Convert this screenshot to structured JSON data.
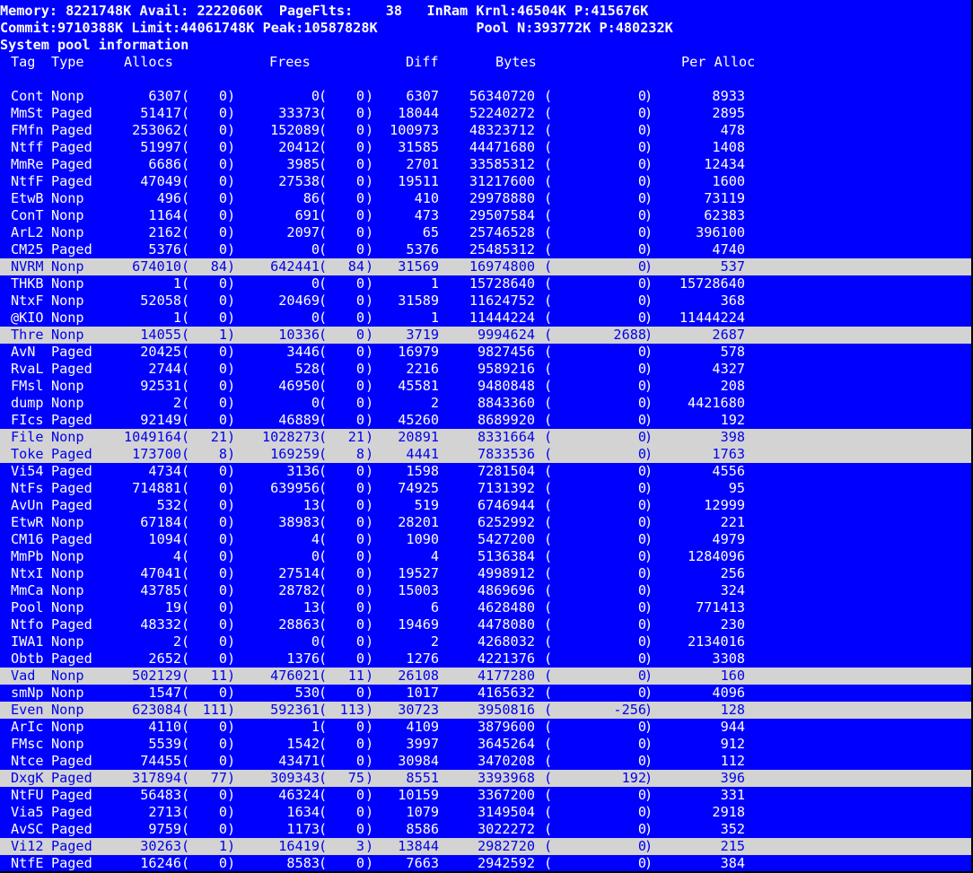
{
  "header": {
    "line1": "Memory: 8221748K Avail: 2222060K  PageFlts:    38   InRam Krnl:46504K P:415676K",
    "line2": "Commit:9710388K Limit:44061748K Peak:10587828K            Pool N:393772K P:480232K",
    "line3": "System pool information"
  },
  "columns": {
    "tag": "Tag",
    "type": "Type",
    "allocs": "Allocs",
    "frees": "Frees",
    "diff": "Diff",
    "bytes": "Bytes",
    "per_alloc": "Per Alloc"
  },
  "colors": {
    "background": "#0000ff",
    "text": "#ffffff",
    "highlight_bg": "#d3d3d3",
    "highlight_text": "#0000ee"
  },
  "rows": [
    {
      "tag": "Cont",
      "type": "Nonp",
      "allocs": "6307",
      "allocs_diff": "0",
      "frees": "0",
      "frees_diff": "0",
      "diff": "6307",
      "bytes": "56340720",
      "bytes_diff": "0",
      "per_alloc": "8933",
      "highlight": false
    },
    {
      "tag": "MmSt",
      "type": "Paged",
      "allocs": "51417",
      "allocs_diff": "0",
      "frees": "33373",
      "frees_diff": "0",
      "diff": "18044",
      "bytes": "52240272",
      "bytes_diff": "0",
      "per_alloc": "2895",
      "highlight": false
    },
    {
      "tag": "FMfn",
      "type": "Paged",
      "allocs": "253062",
      "allocs_diff": "0",
      "frees": "152089",
      "frees_diff": "0",
      "diff": "100973",
      "bytes": "48323712",
      "bytes_diff": "0",
      "per_alloc": "478",
      "highlight": false
    },
    {
      "tag": "Ntff",
      "type": "Paged",
      "allocs": "51997",
      "allocs_diff": "0",
      "frees": "20412",
      "frees_diff": "0",
      "diff": "31585",
      "bytes": "44471680",
      "bytes_diff": "0",
      "per_alloc": "1408",
      "highlight": false
    },
    {
      "tag": "MmRe",
      "type": "Paged",
      "allocs": "6686",
      "allocs_diff": "0",
      "frees": "3985",
      "frees_diff": "0",
      "diff": "2701",
      "bytes": "33585312",
      "bytes_diff": "0",
      "per_alloc": "12434",
      "highlight": false
    },
    {
      "tag": "NtfF",
      "type": "Paged",
      "allocs": "47049",
      "allocs_diff": "0",
      "frees": "27538",
      "frees_diff": "0",
      "diff": "19511",
      "bytes": "31217600",
      "bytes_diff": "0",
      "per_alloc": "1600",
      "highlight": false
    },
    {
      "tag": "EtwB",
      "type": "Nonp",
      "allocs": "496",
      "allocs_diff": "0",
      "frees": "86",
      "frees_diff": "0",
      "diff": "410",
      "bytes": "29978880",
      "bytes_diff": "0",
      "per_alloc": "73119",
      "highlight": false
    },
    {
      "tag": "ConT",
      "type": "Nonp",
      "allocs": "1164",
      "allocs_diff": "0",
      "frees": "691",
      "frees_diff": "0",
      "diff": "473",
      "bytes": "29507584",
      "bytes_diff": "0",
      "per_alloc": "62383",
      "highlight": false
    },
    {
      "tag": "ArL2",
      "type": "Nonp",
      "allocs": "2162",
      "allocs_diff": "0",
      "frees": "2097",
      "frees_diff": "0",
      "diff": "65",
      "bytes": "25746528",
      "bytes_diff": "0",
      "per_alloc": "396100",
      "highlight": false
    },
    {
      "tag": "CM25",
      "type": "Paged",
      "allocs": "5376",
      "allocs_diff": "0",
      "frees": "0",
      "frees_diff": "0",
      "diff": "5376",
      "bytes": "25485312",
      "bytes_diff": "0",
      "per_alloc": "4740",
      "highlight": false
    },
    {
      "tag": "NVRM",
      "type": "Nonp",
      "allocs": "674010",
      "allocs_diff": "84",
      "frees": "642441",
      "frees_diff": "84",
      "diff": "31569",
      "bytes": "16974800",
      "bytes_diff": "0",
      "per_alloc": "537",
      "highlight": true
    },
    {
      "tag": "THKB",
      "type": "Nonp",
      "allocs": "1",
      "allocs_diff": "0",
      "frees": "0",
      "frees_diff": "0",
      "diff": "1",
      "bytes": "15728640",
      "bytes_diff": "0",
      "per_alloc": "15728640",
      "highlight": false
    },
    {
      "tag": "NtxF",
      "type": "Nonp",
      "allocs": "52058",
      "allocs_diff": "0",
      "frees": "20469",
      "frees_diff": "0",
      "diff": "31589",
      "bytes": "11624752",
      "bytes_diff": "0",
      "per_alloc": "368",
      "highlight": false
    },
    {
      "tag": "@KIO",
      "type": "Nonp",
      "allocs": "1",
      "allocs_diff": "0",
      "frees": "0",
      "frees_diff": "0",
      "diff": "1",
      "bytes": "11444224",
      "bytes_diff": "0",
      "per_alloc": "11444224",
      "highlight": false
    },
    {
      "tag": "Thre",
      "type": "Nonp",
      "allocs": "14055",
      "allocs_diff": "1",
      "frees": "10336",
      "frees_diff": "0",
      "diff": "3719",
      "bytes": "9994624",
      "bytes_diff": "2688",
      "per_alloc": "2687",
      "highlight": true
    },
    {
      "tag": "AvN",
      "type": "Paged",
      "allocs": "20425",
      "allocs_diff": "0",
      "frees": "3446",
      "frees_diff": "0",
      "diff": "16979",
      "bytes": "9827456",
      "bytes_diff": "0",
      "per_alloc": "578",
      "highlight": false
    },
    {
      "tag": "RvaL",
      "type": "Paged",
      "allocs": "2744",
      "allocs_diff": "0",
      "frees": "528",
      "frees_diff": "0",
      "diff": "2216",
      "bytes": "9589216",
      "bytes_diff": "0",
      "per_alloc": "4327",
      "highlight": false
    },
    {
      "tag": "FMsl",
      "type": "Nonp",
      "allocs": "92531",
      "allocs_diff": "0",
      "frees": "46950",
      "frees_diff": "0",
      "diff": "45581",
      "bytes": "9480848",
      "bytes_diff": "0",
      "per_alloc": "208",
      "highlight": false
    },
    {
      "tag": "dump",
      "type": "Nonp",
      "allocs": "2",
      "allocs_diff": "0",
      "frees": "0",
      "frees_diff": "0",
      "diff": "2",
      "bytes": "8843360",
      "bytes_diff": "0",
      "per_alloc": "4421680",
      "highlight": false
    },
    {
      "tag": "FIcs",
      "type": "Paged",
      "allocs": "92149",
      "allocs_diff": "0",
      "frees": "46889",
      "frees_diff": "0",
      "diff": "45260",
      "bytes": "8689920",
      "bytes_diff": "0",
      "per_alloc": "192",
      "highlight": false
    },
    {
      "tag": "File",
      "type": "Nonp",
      "allocs": "1049164",
      "allocs_diff": "21",
      "frees": "1028273",
      "frees_diff": "21",
      "diff": "20891",
      "bytes": "8331664",
      "bytes_diff": "0",
      "per_alloc": "398",
      "highlight": true
    },
    {
      "tag": "Toke",
      "type": "Paged",
      "allocs": "173700",
      "allocs_diff": "8",
      "frees": "169259",
      "frees_diff": "8",
      "diff": "4441",
      "bytes": "7833536",
      "bytes_diff": "0",
      "per_alloc": "1763",
      "highlight": true
    },
    {
      "tag": "Vi54",
      "type": "Paged",
      "allocs": "4734",
      "allocs_diff": "0",
      "frees": "3136",
      "frees_diff": "0",
      "diff": "1598",
      "bytes": "7281504",
      "bytes_diff": "0",
      "per_alloc": "4556",
      "highlight": false
    },
    {
      "tag": "NtFs",
      "type": "Paged",
      "allocs": "714881",
      "allocs_diff": "0",
      "frees": "639956",
      "frees_diff": "0",
      "diff": "74925",
      "bytes": "7131392",
      "bytes_diff": "0",
      "per_alloc": "95",
      "highlight": false
    },
    {
      "tag": "AvUn",
      "type": "Paged",
      "allocs": "532",
      "allocs_diff": "0",
      "frees": "13",
      "frees_diff": "0",
      "diff": "519",
      "bytes": "6746944",
      "bytes_diff": "0",
      "per_alloc": "12999",
      "highlight": false
    },
    {
      "tag": "EtwR",
      "type": "Nonp",
      "allocs": "67184",
      "allocs_diff": "0",
      "frees": "38983",
      "frees_diff": "0",
      "diff": "28201",
      "bytes": "6252992",
      "bytes_diff": "0",
      "per_alloc": "221",
      "highlight": false
    },
    {
      "tag": "CM16",
      "type": "Paged",
      "allocs": "1094",
      "allocs_diff": "0",
      "frees": "4",
      "frees_diff": "0",
      "diff": "1090",
      "bytes": "5427200",
      "bytes_diff": "0",
      "per_alloc": "4979",
      "highlight": false
    },
    {
      "tag": "MmPb",
      "type": "Nonp",
      "allocs": "4",
      "allocs_diff": "0",
      "frees": "0",
      "frees_diff": "0",
      "diff": "4",
      "bytes": "5136384",
      "bytes_diff": "0",
      "per_alloc": "1284096",
      "highlight": false
    },
    {
      "tag": "NtxI",
      "type": "Nonp",
      "allocs": "47041",
      "allocs_diff": "0",
      "frees": "27514",
      "frees_diff": "0",
      "diff": "19527",
      "bytes": "4998912",
      "bytes_diff": "0",
      "per_alloc": "256",
      "highlight": false
    },
    {
      "tag": "MmCa",
      "type": "Nonp",
      "allocs": "43785",
      "allocs_diff": "0",
      "frees": "28782",
      "frees_diff": "0",
      "diff": "15003",
      "bytes": "4869696",
      "bytes_diff": "0",
      "per_alloc": "324",
      "highlight": false
    },
    {
      "tag": "Pool",
      "type": "Nonp",
      "allocs": "19",
      "allocs_diff": "0",
      "frees": "13",
      "frees_diff": "0",
      "diff": "6",
      "bytes": "4628480",
      "bytes_diff": "0",
      "per_alloc": "771413",
      "highlight": false
    },
    {
      "tag": "Ntfo",
      "type": "Paged",
      "allocs": "48332",
      "allocs_diff": "0",
      "frees": "28863",
      "frees_diff": "0",
      "diff": "19469",
      "bytes": "4478080",
      "bytes_diff": "0",
      "per_alloc": "230",
      "highlight": false
    },
    {
      "tag": "IWA1",
      "type": "Nonp",
      "allocs": "2",
      "allocs_diff": "0",
      "frees": "0",
      "frees_diff": "0",
      "diff": "2",
      "bytes": "4268032",
      "bytes_diff": "0",
      "per_alloc": "2134016",
      "highlight": false
    },
    {
      "tag": "Obtb",
      "type": "Paged",
      "allocs": "2652",
      "allocs_diff": "0",
      "frees": "1376",
      "frees_diff": "0",
      "diff": "1276",
      "bytes": "4221376",
      "bytes_diff": "0",
      "per_alloc": "3308",
      "highlight": false
    },
    {
      "tag": "Vad",
      "type": "Nonp",
      "allocs": "502129",
      "allocs_diff": "11",
      "frees": "476021",
      "frees_diff": "11",
      "diff": "26108",
      "bytes": "4177280",
      "bytes_diff": "0",
      "per_alloc": "160",
      "highlight": true
    },
    {
      "tag": "smNp",
      "type": "Nonp",
      "allocs": "1547",
      "allocs_diff": "0",
      "frees": "530",
      "frees_diff": "0",
      "diff": "1017",
      "bytes": "4165632",
      "bytes_diff": "0",
      "per_alloc": "4096",
      "highlight": false
    },
    {
      "tag": "Even",
      "type": "Nonp",
      "allocs": "623084",
      "allocs_diff": "111",
      "frees": "592361",
      "frees_diff": "113",
      "diff": "30723",
      "bytes": "3950816",
      "bytes_diff": "-256",
      "per_alloc": "128",
      "highlight": true
    },
    {
      "tag": "ArIc",
      "type": "Nonp",
      "allocs": "4110",
      "allocs_diff": "0",
      "frees": "1",
      "frees_diff": "0",
      "diff": "4109",
      "bytes": "3879600",
      "bytes_diff": "0",
      "per_alloc": "944",
      "highlight": false
    },
    {
      "tag": "FMsc",
      "type": "Nonp",
      "allocs": "5539",
      "allocs_diff": "0",
      "frees": "1542",
      "frees_diff": "0",
      "diff": "3997",
      "bytes": "3645264",
      "bytes_diff": "0",
      "per_alloc": "912",
      "highlight": false
    },
    {
      "tag": "Ntce",
      "type": "Paged",
      "allocs": "74455",
      "allocs_diff": "0",
      "frees": "43471",
      "frees_diff": "0",
      "diff": "30984",
      "bytes": "3470208",
      "bytes_diff": "0",
      "per_alloc": "112",
      "highlight": false
    },
    {
      "tag": "DxgK",
      "type": "Paged",
      "allocs": "317894",
      "allocs_diff": "77",
      "frees": "309343",
      "frees_diff": "75",
      "diff": "8551",
      "bytes": "3393968",
      "bytes_diff": "192",
      "per_alloc": "396",
      "highlight": true
    },
    {
      "tag": "NtFU",
      "type": "Paged",
      "allocs": "56483",
      "allocs_diff": "0",
      "frees": "46324",
      "frees_diff": "0",
      "diff": "10159",
      "bytes": "3367200",
      "bytes_diff": "0",
      "per_alloc": "331",
      "highlight": false
    },
    {
      "tag": "Via5",
      "type": "Paged",
      "allocs": "2713",
      "allocs_diff": "0",
      "frees": "1634",
      "frees_diff": "0",
      "diff": "1079",
      "bytes": "3149504",
      "bytes_diff": "0",
      "per_alloc": "2918",
      "highlight": false
    },
    {
      "tag": "AvSC",
      "type": "Paged",
      "allocs": "9759",
      "allocs_diff": "0",
      "frees": "1173",
      "frees_diff": "0",
      "diff": "8586",
      "bytes": "3022272",
      "bytes_diff": "0",
      "per_alloc": "352",
      "highlight": false
    },
    {
      "tag": "Vi12",
      "type": "Paged",
      "allocs": "30263",
      "allocs_diff": "1",
      "frees": "16419",
      "frees_diff": "3",
      "diff": "13844",
      "bytes": "2982720",
      "bytes_diff": "0",
      "per_alloc": "215",
      "highlight": true
    },
    {
      "tag": "NtfE",
      "type": "Paged",
      "allocs": "16246",
      "allocs_diff": "0",
      "frees": "8583",
      "frees_diff": "0",
      "diff": "7663",
      "bytes": "2942592",
      "bytes_diff": "0",
      "per_alloc": "384",
      "highlight": false
    }
  ]
}
